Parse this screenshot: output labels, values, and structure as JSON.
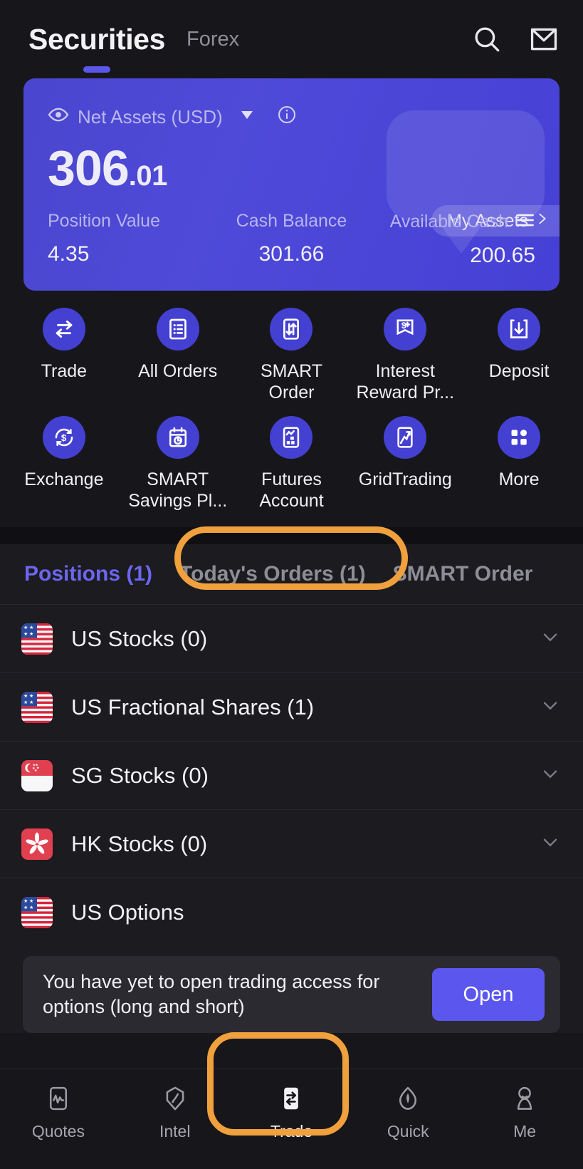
{
  "header": {
    "title": "Securities",
    "secondary_tab": "Forex",
    "search_icon": "search-icon",
    "mail_icon": "mail-icon",
    "active_indicator_color": "#5b57e8"
  },
  "asset_card": {
    "eye_icon": "eye-icon",
    "label": "Net Assets (USD)",
    "dropdown_icon": "caret-down-icon",
    "info_icon": "info-circle-icon",
    "amount_integer": "306",
    "amount_decimal": ".01",
    "my_assets_label": "My Assets",
    "my_assets_chevron": "chevron-right-icon",
    "metrics": [
      {
        "label": "Position Value",
        "value": "4.35",
        "icon": null
      },
      {
        "label": "Cash Balance",
        "value": "301.66",
        "icon": null
      },
      {
        "label": "Available Cash",
        "value": "200.65",
        "icon": "hamburger-icon"
      }
    ],
    "gradient_from": "#4a46cf",
    "gradient_to": "#4640d6"
  },
  "action_grid": {
    "circle_color": "#4440d2",
    "items": [
      {
        "label": "Trade",
        "icon": "swap-arrows-icon"
      },
      {
        "label": "All Orders",
        "icon": "list-document-icon"
      },
      {
        "label": "SMART\nOrder",
        "icon": "updown-arrows-phone-icon"
      },
      {
        "label": "Interest\nReward Pr...",
        "icon": "dollar-plus-banner-icon"
      },
      {
        "label": "Deposit",
        "icon": "download-box-icon"
      },
      {
        "label": "Exchange",
        "icon": "dollar-refresh-icon"
      },
      {
        "label": "SMART\nSavings Pl...",
        "icon": "calendar-clock-icon"
      },
      {
        "label": "Futures\nAccount",
        "icon": "chart-blocks-phone-icon"
      },
      {
        "label": "GridTrading",
        "icon": "grid-chart-phone-icon"
      },
      {
        "label": "More",
        "icon": "apps-grid-icon"
      }
    ]
  },
  "tabs": {
    "items": [
      {
        "label": "Positions (1)",
        "active": true
      },
      {
        "label": "Today's Orders (1)",
        "active": false
      },
      {
        "label": "SMART Order",
        "active": false
      }
    ],
    "active_color": "#6c66f0",
    "inactive_color": "#8d8d95"
  },
  "positions_list": {
    "rows": [
      {
        "label": "US Stocks (0)",
        "flag": "us-flag-icon",
        "chevron": "chevron-down-icon"
      },
      {
        "label": "US Fractional Shares (1)",
        "flag": "us-flag-icon",
        "chevron": "chevron-down-icon"
      },
      {
        "label": "SG Stocks (0)",
        "flag": "sg-flag-icon",
        "chevron": "chevron-down-icon"
      },
      {
        "label": "HK Stocks (0)",
        "flag": "hk-flag-icon",
        "chevron": "chevron-down-icon"
      },
      {
        "label": "US Options",
        "flag": "us-flag-icon",
        "chevron": null
      }
    ]
  },
  "options_banner": {
    "text": "You have yet to open trading access for options (long and short)",
    "button_label": "Open",
    "button_color": "#5b57ee"
  },
  "bottom_nav": {
    "items": [
      {
        "label": "Quotes",
        "icon": "pulse-chart-icon",
        "active": false
      },
      {
        "label": "Intel",
        "icon": "hexagon-compass-icon",
        "active": false
      },
      {
        "label": "Trade",
        "icon": "swap-arrows-card-icon",
        "active": true
      },
      {
        "label": "Quick",
        "icon": "leaf-drop-icon",
        "active": false
      },
      {
        "label": "Me",
        "icon": "person-icon",
        "active": false
      }
    ]
  },
  "annotations": {
    "highlight_color": "#f0a03c",
    "targets": [
      "tab-todays-orders",
      "nav-item-trade"
    ]
  }
}
